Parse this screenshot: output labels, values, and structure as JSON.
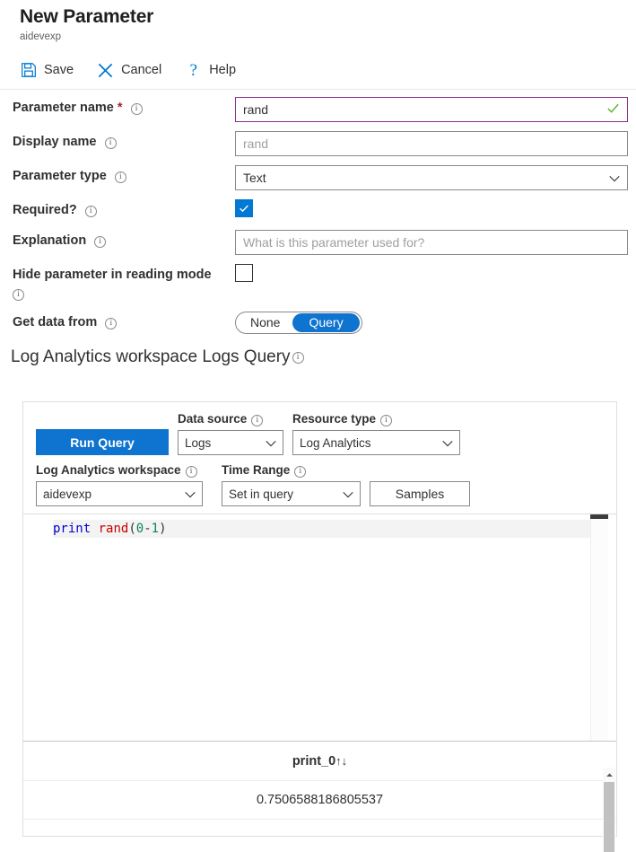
{
  "header": {
    "title": "New Parameter",
    "subtitle": "aidevexp"
  },
  "commands": [
    {
      "label": "Save",
      "icon": "save-icon"
    },
    {
      "label": "Cancel",
      "icon": "close-icon"
    },
    {
      "label": "Help",
      "icon": "question-icon"
    }
  ],
  "form": {
    "parameter_name": {
      "label": "Parameter name",
      "required_marker": "*",
      "value": "rand",
      "validation_icon": "check-icon",
      "focused": true
    },
    "display_name": {
      "label": "Display name",
      "placeholder": "rand",
      "value": ""
    },
    "parameter_type": {
      "label": "Parameter type",
      "value": "Text"
    },
    "required": {
      "label": "Required?",
      "checked": true
    },
    "explanation": {
      "label": "Explanation",
      "placeholder": "What is this parameter used for?",
      "value": ""
    },
    "hide_parameter": {
      "label": "Hide parameter in reading mode",
      "checked": false
    },
    "get_data_from": {
      "label": "Get data from",
      "options": [
        "None",
        "Query"
      ],
      "selected": "Query"
    }
  },
  "query_section": {
    "heading": "Log Analytics workspace Logs Query",
    "run_button": "Run Query",
    "data_source": {
      "label": "Data source",
      "value": "Logs"
    },
    "resource_type": {
      "label": "Resource type",
      "value": "Log Analytics"
    },
    "workspace": {
      "label": "Log Analytics workspace",
      "value": "aidevexp"
    },
    "time_range": {
      "label": "Time Range",
      "value": "Set in query"
    },
    "samples_button": "Samples",
    "editor": {
      "tokens": [
        {
          "text": "print",
          "type": "keyword"
        },
        {
          "text": " ",
          "type": "plain"
        },
        {
          "text": "rand",
          "type": "function"
        },
        {
          "text": "(",
          "type": "punct"
        },
        {
          "text": "0",
          "type": "number"
        },
        {
          "text": "-",
          "type": "punct"
        },
        {
          "text": "1",
          "type": "number"
        },
        {
          "text": ")",
          "type": "punct"
        }
      ],
      "text": "print rand(0-1)"
    },
    "results": {
      "column_header": "print_0",
      "sort_indicator": "↑↓",
      "rows": [
        {
          "value": "0.7506588186805537"
        }
      ]
    }
  },
  "colors": {
    "accent": "#0078d4",
    "accent_button": "#0f73d0",
    "focus_border": "#8b2f8b",
    "success": "#5cb531",
    "required": "#a4262c"
  }
}
